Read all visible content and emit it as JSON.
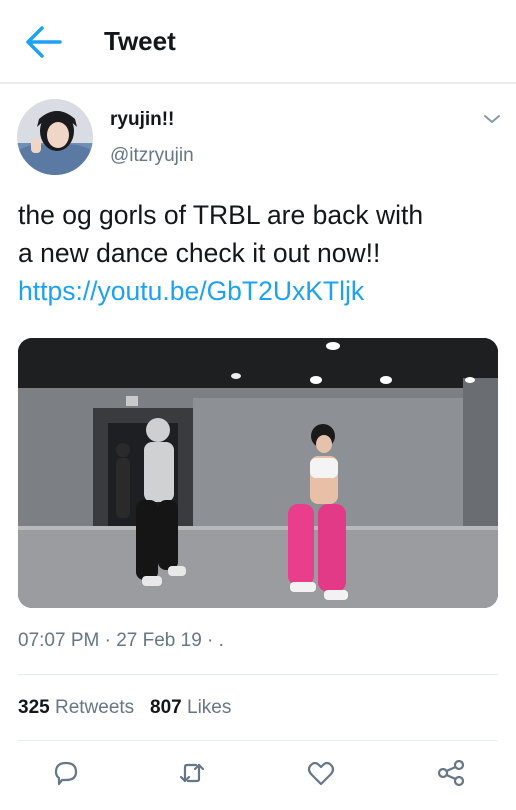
{
  "header": {
    "title": "Tweet",
    "back_icon": "arrow-left-icon",
    "accent": "#1da1f2"
  },
  "tweet": {
    "author": {
      "display_name": "ryujin!!",
      "handle": "@itzryujin"
    },
    "text_line1": "the og gorls of TRBL are back with",
    "text_line2": "a new dance check it out now!!",
    "link": "https://youtu.be/GbT2UxKTljk",
    "timestamp": "07:07 PM · 27 Feb 19 · ."
  },
  "stats": {
    "retweets_count": "325",
    "retweets_label": "Retweets",
    "likes_count": "807",
    "likes_label": "Likes"
  },
  "actions": [
    "reply-icon",
    "retweet-icon",
    "like-icon",
    "share-icon"
  ]
}
